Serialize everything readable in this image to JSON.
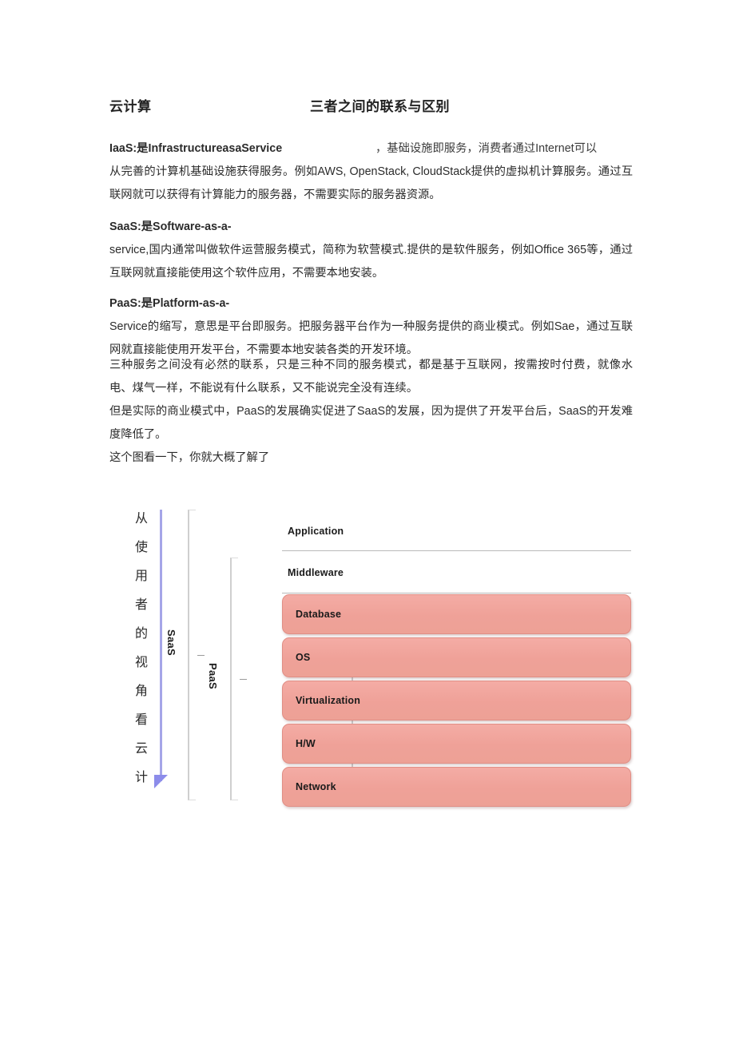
{
  "document": {
    "heading": {
      "left": "云计算",
      "center": "三者之间的联系与区别"
    },
    "paragraphs": {
      "iaas": {
        "head_label": "IaaS:是InfrastructureasaService",
        "head_tail": "，基础设施即服务，消费者通过Internet可以",
        "body": "从完善的计算机基础设施获得服务。例如AWS, OpenStack, CloudStack提供的虚拟机计算服务。通过互联网就可以获得有计算能力的服务器，不需要实际的服务器资源。"
      },
      "saas": {
        "head_label": "SaaS:是Software-as-a-",
        "head_tail": "",
        "body": "service,国内通常叫做软件运营服务模式，简称为软营模式.提供的是软件服务，例如Office 365等，通过互联网就直接能使用这个软件应用，不需要本地安装。"
      },
      "paas": {
        "head_label": "PaaS:是Platform-as-a-",
        "head_tail": "",
        "body": "Service的缩写，意思是平台即服务。把服务器平台作为一种服务提供的商业模式。例如Sae，通过互联网就直接能使用开发平台，不需要本地安装各类的开发环境。"
      },
      "closing": [
        "三种服务之间没有必然的联系，只是三种不同的服务模式，都是基于互联网，按需按时付费，就像水电、煤气一样，不能说有什么联系，又不能说完全没有连续。",
        "但是实际的商业模式中，PaaS的发展确实促进了SaaS的发展，因为提供了开发平台后，SaaS的开发难度降低了。",
        "这个图看一下，你就大概了解了"
      ]
    }
  },
  "diagram": {
    "vertical_caption": [
      "从",
      "使",
      "用",
      "者",
      "的",
      "视",
      "角",
      "看",
      "云",
      "计"
    ],
    "scope_labels": {
      "saas": "SaaS",
      "paas": "PaaS"
    },
    "plain_layers": [
      {
        "label": "Application"
      },
      {
        "label": "Middleware"
      }
    ],
    "stack_layers": [
      {
        "label": "Database"
      },
      {
        "label": "OS"
      },
      {
        "label": "Virtualization"
      },
      {
        "label": "H/W"
      },
      {
        "label": "Network"
      }
    ],
    "colors": {
      "box_fill": "#efa198",
      "box_border": "#e08e85",
      "arrow": "#8c8cea",
      "rule": "#a5a5e8",
      "bracket": "#cfcfcf"
    }
  }
}
